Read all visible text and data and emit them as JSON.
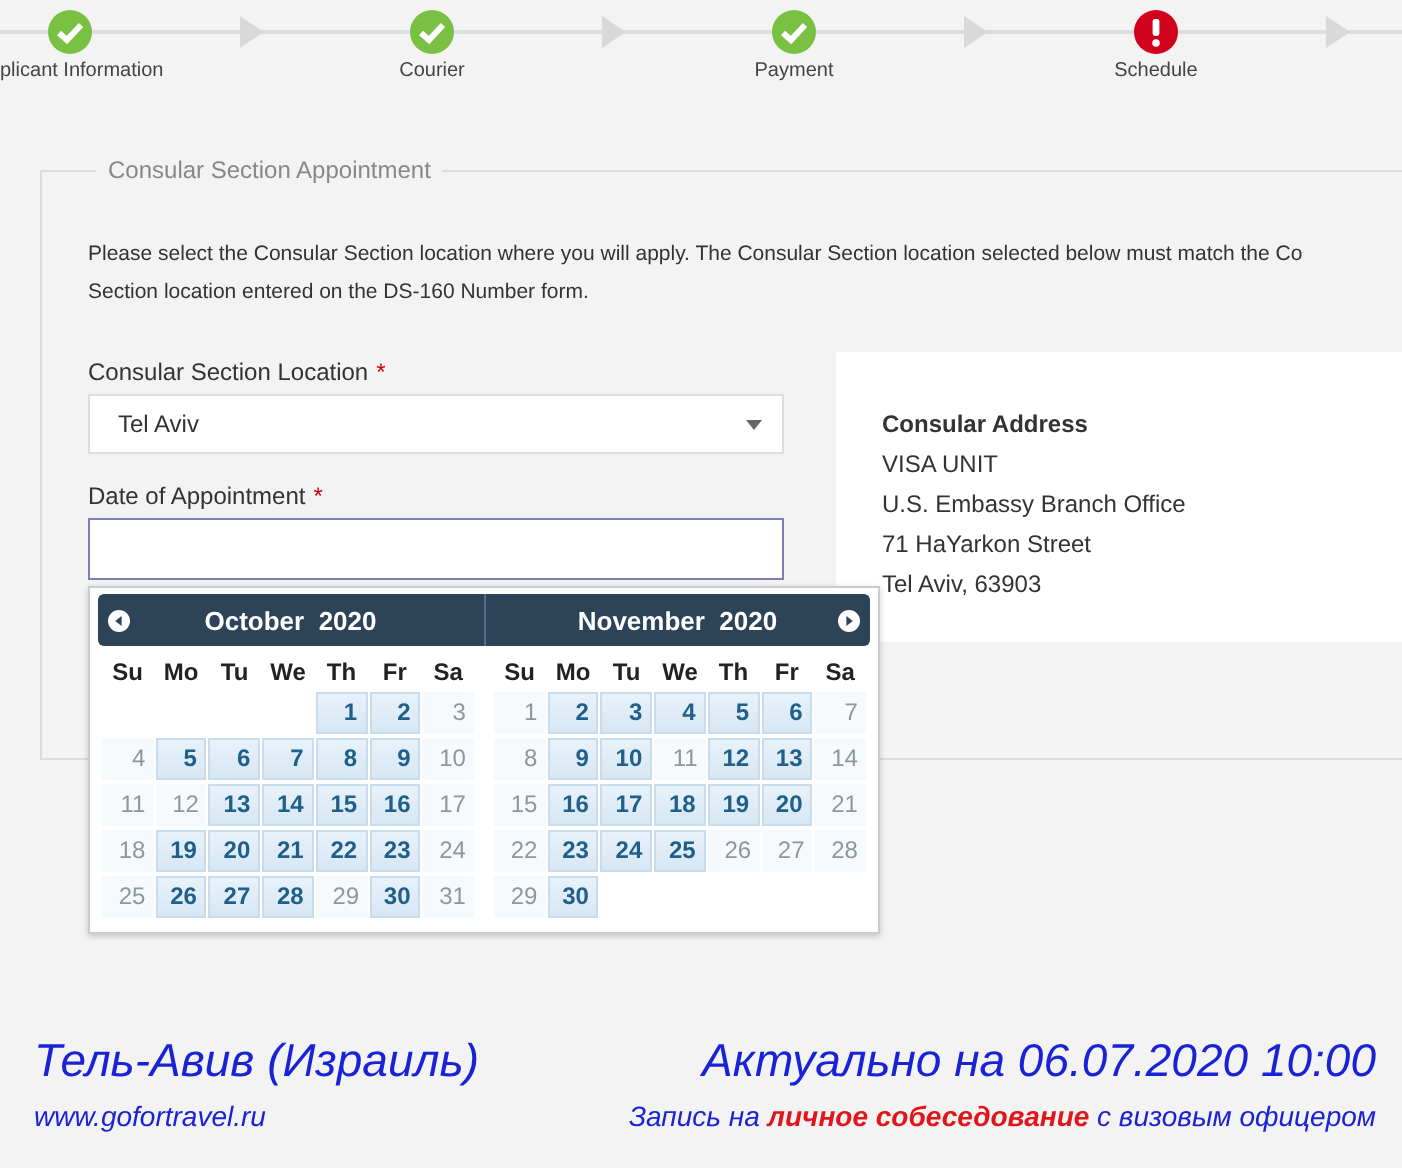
{
  "steps": [
    {
      "label": "plicant Information",
      "complete": true
    },
    {
      "label": "Courier",
      "complete": true
    },
    {
      "label": "Payment",
      "complete": true
    },
    {
      "label": "Schedule",
      "complete": false
    }
  ],
  "form": {
    "legend": "Consular Section Appointment",
    "intro": "Please select the Consular Section location where you will apply. The Consular Section location selected below must match the Co\nSection location entered on the DS-160 Number form.",
    "location_label": "Consular Section Location",
    "location_required": "*",
    "location_value": "Tel Aviv",
    "date_label": "Date of Appointment",
    "date_required": "*",
    "address": {
      "title": "Consular Address",
      "lines": [
        "VISA UNIT",
        "U.S. Embassy Branch Office",
        "71 HaYarkon Street",
        "Tel Aviv, 63903"
      ]
    }
  },
  "calendar": {
    "months": [
      {
        "title": "October  2020",
        "weekdays": [
          "Su",
          "Mo",
          "Tu",
          "We",
          "Th",
          "Fr",
          "Sa"
        ],
        "weeks": [
          {
            "right_aligned": true,
            "days": [
              {
                "day": "1",
                "available": true
              },
              {
                "day": "2",
                "available": true
              },
              {
                "day": "3",
                "available": false
              }
            ]
          },
          {
            "right_aligned": false,
            "days": [
              {
                "day": "4",
                "available": false
              },
              {
                "day": "5",
                "available": true
              },
              {
                "day": "6",
                "available": true
              },
              {
                "day": "7",
                "available": true
              },
              {
                "day": "8",
                "available": true
              },
              {
                "day": "9",
                "available": true
              },
              {
                "day": "10",
                "available": false
              }
            ]
          },
          {
            "right_aligned": false,
            "days": [
              {
                "day": "11",
                "available": false
              },
              {
                "day": "12",
                "available": false
              },
              {
                "day": "13",
                "available": true
              },
              {
                "day": "14",
                "available": true
              },
              {
                "day": "15",
                "available": true
              },
              {
                "day": "16",
                "available": true
              },
              {
                "day": "17",
                "available": false
              }
            ]
          },
          {
            "right_aligned": false,
            "days": [
              {
                "day": "18",
                "available": false
              },
              {
                "day": "19",
                "available": true
              },
              {
                "day": "20",
                "available": true
              },
              {
                "day": "21",
                "available": true
              },
              {
                "day": "22",
                "available": true
              },
              {
                "day": "23",
                "available": true
              },
              {
                "day": "24",
                "available": false
              }
            ]
          },
          {
            "right_aligned": false,
            "days": [
              {
                "day": "25",
                "available": false
              },
              {
                "day": "26",
                "available": true
              },
              {
                "day": "27",
                "available": true
              },
              {
                "day": "28",
                "available": true
              },
              {
                "day": "29",
                "available": false
              },
              {
                "day": "30",
                "available": true
              },
              {
                "day": "31",
                "available": false
              }
            ]
          }
        ]
      },
      {
        "title": "November  2020",
        "weekdays": [
          "Su",
          "Mo",
          "Tu",
          "We",
          "Th",
          "Fr",
          "Sa"
        ],
        "weeks": [
          {
            "right_aligned": false,
            "days": [
              {
                "day": "1",
                "available": false
              },
              {
                "day": "2",
                "available": true
              },
              {
                "day": "3",
                "available": true
              },
              {
                "day": "4",
                "available": true
              },
              {
                "day": "5",
                "available": true
              },
              {
                "day": "6",
                "available": true
              },
              {
                "day": "7",
                "available": false
              }
            ]
          },
          {
            "right_aligned": false,
            "days": [
              {
                "day": "8",
                "available": false
              },
              {
                "day": "9",
                "available": true
              },
              {
                "day": "10",
                "available": true
              },
              {
                "day": "11",
                "available": false
              },
              {
                "day": "12",
                "available": true
              },
              {
                "day": "13",
                "available": true
              },
              {
                "day": "14",
                "available": false
              }
            ]
          },
          {
            "right_aligned": false,
            "days": [
              {
                "day": "15",
                "available": false
              },
              {
                "day": "16",
                "available": true
              },
              {
                "day": "17",
                "available": true
              },
              {
                "day": "18",
                "available": true
              },
              {
                "day": "19",
                "available": true
              },
              {
                "day": "20",
                "available": true
              },
              {
                "day": "21",
                "available": false
              }
            ]
          },
          {
            "right_aligned": false,
            "days": [
              {
                "day": "22",
                "available": false
              },
              {
                "day": "23",
                "available": true
              },
              {
                "day": "24",
                "available": true
              },
              {
                "day": "25",
                "available": true
              },
              {
                "day": "26",
                "available": false
              },
              {
                "day": "27",
                "available": false
              },
              {
                "day": "28",
                "available": false
              }
            ]
          },
          {
            "right_aligned": false,
            "days": [
              {
                "day": "29",
                "available": false
              },
              {
                "day": "30",
                "available": true
              }
            ]
          }
        ]
      }
    ]
  },
  "caption": {
    "city": "Тель-Авив (Израиль)",
    "updated": "Актуально на 06.07.2020 10:00",
    "site": "www.gofortravel.ru",
    "note": "Запись на **личное собеседование** с визовым офицером"
  }
}
